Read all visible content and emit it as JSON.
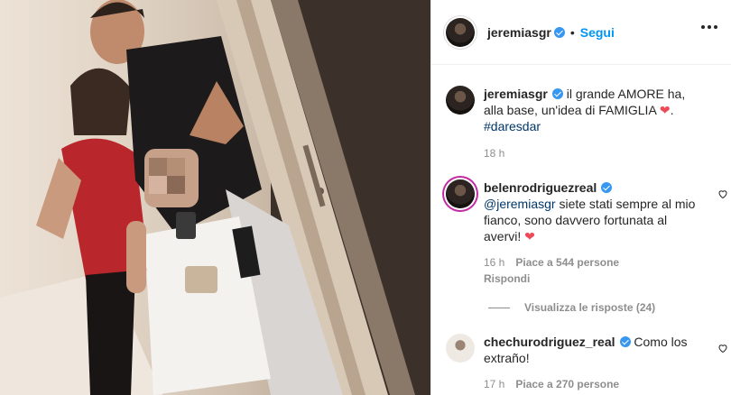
{
  "post": {
    "username": "jeremiasgr",
    "follow_label": "Segui",
    "caption_text": " il grande AMORE ha, alla base, un'idea di FAMIGLIA ",
    "caption_hashtag": "#daresdar",
    "caption_time": "18 h"
  },
  "comments": [
    {
      "username": "belenrodriguezreal",
      "mention": "@jeremiasgr",
      "text": " siete stati sempre al mio fianco, sono davvero fortunata al avervi! ",
      "time": "16 h",
      "likes": "Piace a 544 persone",
      "reply": "Rispondi",
      "view_replies": "Visualizza le risposte (24)"
    },
    {
      "username": "chechurodriguez_real",
      "text": " Como los extraño!",
      "time": "17 h",
      "likes": "Piace a 270 persone"
    }
  ],
  "icons": {
    "verified": "verified-badge-icon",
    "heart": "heart-icon",
    "like": "heart-outline-icon",
    "more": "more-options-icon"
  },
  "colors": {
    "accent": "#0095f6",
    "verified": "#3897f0",
    "heart": "#ed4956",
    "meta": "#8e8e8e"
  }
}
